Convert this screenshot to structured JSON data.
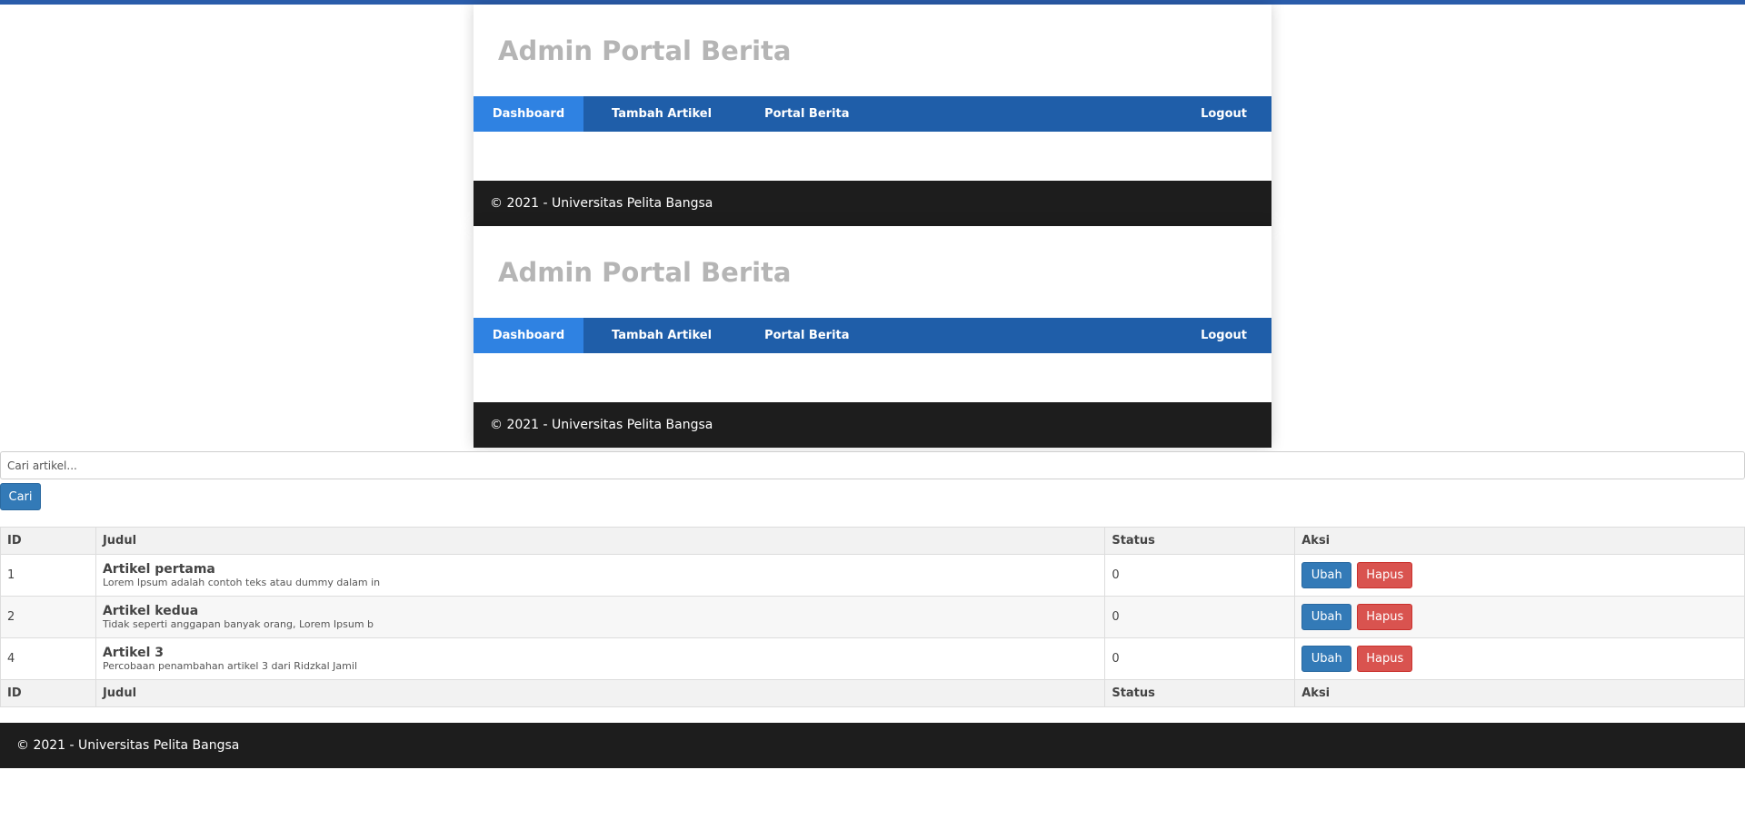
{
  "site": {
    "title": "Admin Portal Berita",
    "footer": "© 2021 - Universitas Pelita Bangsa"
  },
  "nav": {
    "dashboard": "Dashboard",
    "tambah_artikel": "Tambah Artikel",
    "portal_berita": "Portal Berita",
    "logout": "Logout"
  },
  "search": {
    "placeholder": "Cari artikel...",
    "button": "Cari"
  },
  "table": {
    "headers": {
      "id": "ID",
      "judul": "Judul",
      "status": "Status",
      "aksi": "Aksi"
    },
    "rows": [
      {
        "id": "1",
        "title": "Artikel pertama",
        "excerpt": "Lorem Ipsum adalah contoh teks atau dummy dalam in",
        "status": "0",
        "edit": "Ubah",
        "delete": "Hapus"
      },
      {
        "id": "2",
        "title": "Artikel kedua",
        "excerpt": "Tidak seperti anggapan banyak orang, Lorem Ipsum b",
        "status": "0",
        "edit": "Ubah",
        "delete": "Hapus"
      },
      {
        "id": "4",
        "title": "Artikel 3",
        "excerpt": "Percobaan penambahan artikel 3 dari Ridzkal Jamil",
        "status": "0",
        "edit": "Ubah",
        "delete": "Hapus"
      }
    ]
  },
  "colors": {
    "top_bar": "#2a5caa",
    "nav_bg": "#1f5ea9",
    "nav_active": "#2f82e2",
    "footer_bg": "#1d1d1d",
    "primary_button": "#337ab7",
    "danger_button": "#d9534f"
  }
}
